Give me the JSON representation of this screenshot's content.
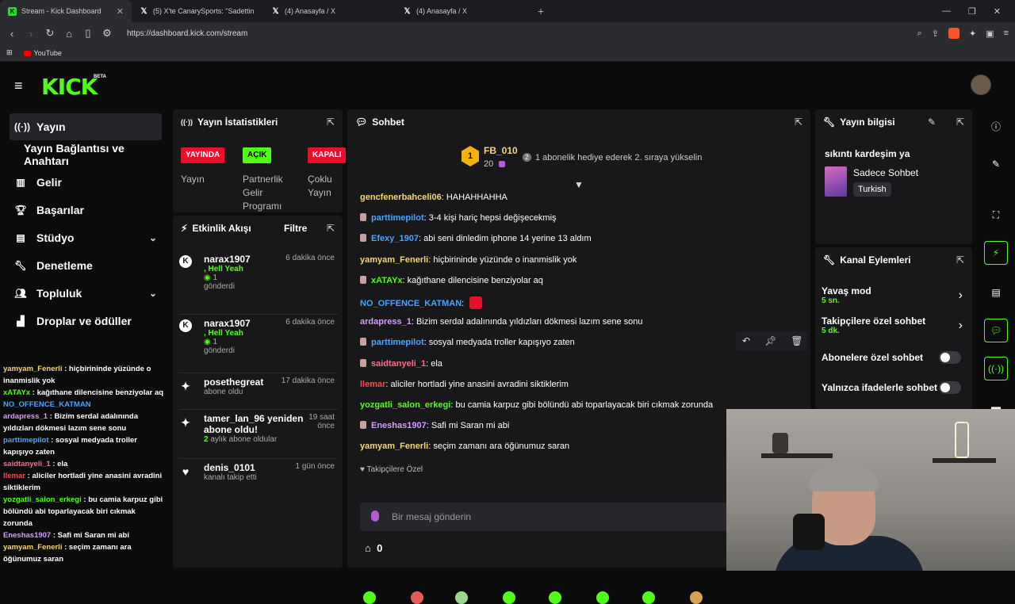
{
  "browser": {
    "tabs": [
      {
        "label": "Stream - Kick Dashboard",
        "icon": "kick-favicon",
        "active": true
      },
      {
        "label": "(5) X'te CanarySports: \"Sadettin S",
        "icon": "x-favicon",
        "active": false
      },
      {
        "label": "(4) Anasayfa / X",
        "icon": "x-favicon",
        "active": false
      },
      {
        "label": "(4) Anasayfa / X",
        "icon": "x-favicon",
        "active": false
      }
    ],
    "url": "https://dashboard.kick.com/stream",
    "bookmarks": [
      {
        "label": "YouTube"
      }
    ]
  },
  "header": {
    "logo": "KICK",
    "beta": "BETA"
  },
  "sidebar": {
    "items": [
      {
        "label": "Yayın",
        "icon": "broadcast-icon"
      },
      {
        "label": "Yayın Bağlantısı ve Anahtarı",
        "icon": ""
      },
      {
        "label": "Gelir",
        "icon": "chart-icon"
      },
      {
        "label": "Başarılar",
        "icon": "trophy-icon"
      },
      {
        "label": "Stüdyo",
        "icon": "studio-icon"
      },
      {
        "label": "Denetleme",
        "icon": "wrench-icon"
      },
      {
        "label": "Topluluk",
        "icon": "people-icon"
      },
      {
        "label": "Droplar ve ödüller",
        "icon": "drops-icon"
      }
    ]
  },
  "overlay_chat": [
    {
      "user": "yamyam_Fenerli",
      "text": "hiçbirininde yüzünde o inanmislik yok",
      "color": "#f5d76e"
    },
    {
      "user": "xATAYx",
      "text": "kağıthane dilencisine benziyolar aq",
      "color": "#53fc18"
    },
    {
      "user": "NO_OFFENCE_KATMAN",
      "text": "",
      "color": "#4aa3ff"
    },
    {
      "user": "ardapress_1",
      "text": "Bizim serdal adalınında yıldızları dökmesi lazım sene sonu",
      "color": "#d59bff"
    },
    {
      "user": "parttimepilot",
      "text": "sosyal medyada troller kapışıyo zaten",
      "color": "#4aa3ff"
    },
    {
      "user": "saidtanyeli_1",
      "text": "ela",
      "color": "#ff6b8a"
    },
    {
      "user": "llemar",
      "text": "aliciler hortladi yine anasini avradini siktiklerim",
      "color": "#ff4a4a"
    },
    {
      "user": "yozgatli_salon_erkegi",
      "text": "bu camia karpuz gibi bölündü abi toparlayacak biri cıkmak zorunda",
      "color": "#53fc18"
    },
    {
      "user": "Eneshas1907",
      "text": "Safi mi Saran mi abi",
      "color": "#d59bff"
    },
    {
      "user": "yamyam_Fenerli",
      "text": "seçim zamanı ara öğünumuz saran",
      "color": "#f5d76e"
    }
  ],
  "stats_panel": {
    "title": "Yayın İstatistikleri",
    "items": [
      {
        "badge": "YAYINDA",
        "badge_color": "#e6112b",
        "label": "Yayın"
      },
      {
        "badge": "AÇIK",
        "badge_color": "#53fc18",
        "label": "Partnerlik Gelir Programı"
      },
      {
        "badge": "KAPALI",
        "badge_color": "#e6112b",
        "label": "Çoklu Yayın"
      }
    ]
  },
  "activity_panel": {
    "title": "Etkinlik Akışı",
    "filter": "Filtre",
    "events": [
      {
        "user": "narax1907",
        "time": "6 dakika önce",
        "line2": ", Hell Yeah",
        "count": "1",
        "line3": "gönderdi"
      },
      {
        "user": "narax1907",
        "time": "6 dakika önce",
        "line2": ", Hell Yeah",
        "count": "1",
        "line3": "gönderdi"
      },
      {
        "user": "posethegreat",
        "time": "17 dakika önce",
        "line2": "abone oldu"
      },
      {
        "user": "tamer_lan_96 yeniden abone oldu!",
        "time": "19 saat önce",
        "months": "2",
        "line2": "aylık abone oldular"
      },
      {
        "user": "denis_0101",
        "time": "1 gün önce",
        "line2": "kanalı takip etti"
      }
    ]
  },
  "chat_panel": {
    "title": "Sohbet",
    "leader": {
      "rank": "1",
      "name": "FB_010",
      "amount": "20"
    },
    "promo": "1 abonelik hediye ederek 2. sıraya yükselin",
    "messages": [
      {
        "user": "gencfenerbahceli06",
        "text": "HAHAHHAHHA",
        "color": "#f5d76e",
        "badge": false
      },
      {
        "user": "parttimepilot",
        "text": "3-4 kişi hariç hepsi değişecekmiş",
        "color": "#4aa3ff",
        "badge": true
      },
      {
        "user": "Efexy_1907",
        "text": "abi seni dinledim iphone 14 yerine 13 aldım",
        "color": "#4aa3ff",
        "badge": true
      },
      {
        "user": "yamyam_Fenerli",
        "text": "hiçbirininde yüzünde o inanmislik yok",
        "color": "#f5d76e",
        "badge": false
      },
      {
        "user": "xATAYx",
        "text": "kağıthane dilencisine benziyolar aq",
        "color": "#53fc18",
        "badge": true
      },
      {
        "user": "NO_OFFENCE_KATMAN",
        "text": "",
        "color": "#4aa3ff",
        "badge": false
      },
      {
        "user": "ardapress_1",
        "text": "Bizim serdal adalınında yıldızları dökmesi lazım sene sonu",
        "color": "#d59bff",
        "badge": false
      },
      {
        "user": "parttimepilot",
        "text": "sosyal medyada troller kapışıyo zaten",
        "color": "#4aa3ff",
        "badge": true
      },
      {
        "user": "saidtanyeli_1",
        "text": "ela",
        "color": "#ff6b8a",
        "badge": true
      },
      {
        "user": "llemar",
        "text": "aliciler hortladi yine anasini avradini siktiklerim",
        "color": "#ff4a4a",
        "badge": false
      },
      {
        "user": "yozgatli_salon_erkegi",
        "text": "bu camia karpuz gibi bölündü abi toparlayacak biri cıkmak zorunda",
        "color": "#53fc18",
        "badge": false
      },
      {
        "user": "Eneshas1907",
        "text": "Safi mi Saran mi abi",
        "color": "#d59bff",
        "badge": true
      },
      {
        "user": "yamyam_Fenerli",
        "text": "seçim zamanı ara öğünumuz saran",
        "color": "#f5d76e",
        "badge": false
      }
    ],
    "followers_only": "Takipçilere Özel",
    "input_placeholder": "Bir mesaj gönderin",
    "kicks": "0"
  },
  "stream_info": {
    "title": "Yayın bilgisi",
    "stream_title": "sıkıntı kardeşim ya",
    "category": "Sadece Sohbet",
    "language": "Turkish"
  },
  "channel_actions": {
    "title": "Kanal Eylemleri",
    "items": [
      {
        "label": "Yavaş mod",
        "sub": "5 sn.",
        "type": "chevron"
      },
      {
        "label": "Takipçilere özel sohbet",
        "sub": "5 dk.",
        "type": "chevron"
      },
      {
        "label": "Abonelere özel sohbet",
        "type": "toggle"
      },
      {
        "label": "Yalnızca ifadelerle sohbet",
        "type": "toggle"
      }
    ]
  }
}
